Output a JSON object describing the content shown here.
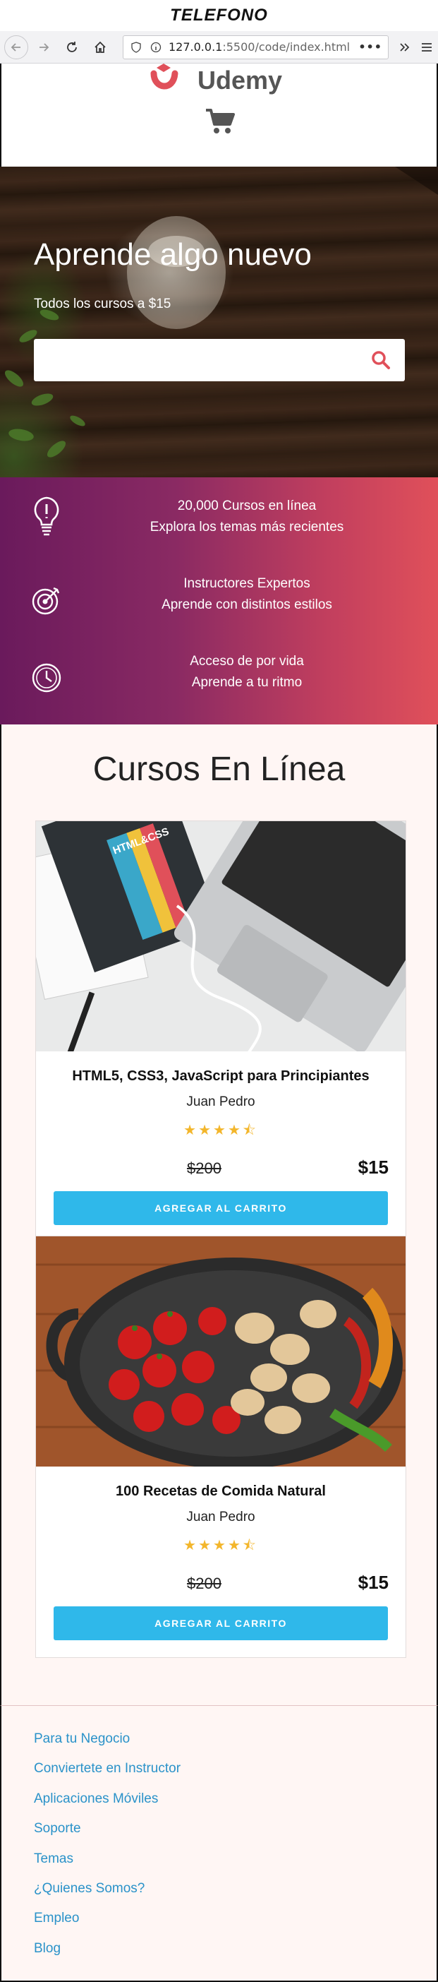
{
  "caption": "TELEFONO",
  "browser": {
    "url_host": "127.0.0.1",
    "url_rest": ":5500/code/index.html",
    "menu_dots": "•••"
  },
  "header": {
    "logo_text": "Udemy",
    "cart_icon": "cart-icon"
  },
  "hero": {
    "title": "Aprende algo nuevo",
    "subtitle": "Todos los cursos a $15",
    "search_placeholder": ""
  },
  "features": [
    {
      "icon": "lightbulb-icon",
      "line1": "20,000 Cursos en línea",
      "line2": "Explora los temas más recientes"
    },
    {
      "icon": "target-icon",
      "line1": "Instructores Expertos",
      "line2": "Aprende con distintos estilos"
    },
    {
      "icon": "clock-icon",
      "line1": "Acceso de por vida",
      "line2": "Aprende a tu ritmo"
    }
  ],
  "courses": {
    "heading": "Cursos En Línea",
    "items": [
      {
        "title": "HTML5, CSS3, JavaScript para Principiantes",
        "author": "Juan Pedro",
        "rating": 4.5,
        "stars": "★★★★⯪",
        "old_price": "$200",
        "price": "$15",
        "button": "AGREGAR AL CARRITO",
        "image": "laptop-and-html-css-book",
        "book_label": "HTML&CSS"
      },
      {
        "title": "100 Recetas de Comida Natural",
        "author": "Juan Pedro",
        "rating": 4.5,
        "stars": "★★★★⯪",
        "old_price": "$200",
        "price": "$15",
        "button": "AGREGAR AL CARRITO",
        "image": "pan-with-tomatoes-and-mushrooms"
      }
    ]
  },
  "footer": {
    "links": [
      "Para tu Negocio",
      "Conviertete en Instructor",
      "Aplicaciones Móviles",
      "Soporte",
      "Temas",
      "¿Quienes Somos?",
      "Empleo",
      "Blog"
    ]
  },
  "colors": {
    "accent_blue": "#2fb8ea",
    "brand_red": "#e0505a",
    "brand_purple": "#6a1a5c",
    "link_blue": "#2a92c9",
    "star_yellow": "#f3b62b"
  }
}
